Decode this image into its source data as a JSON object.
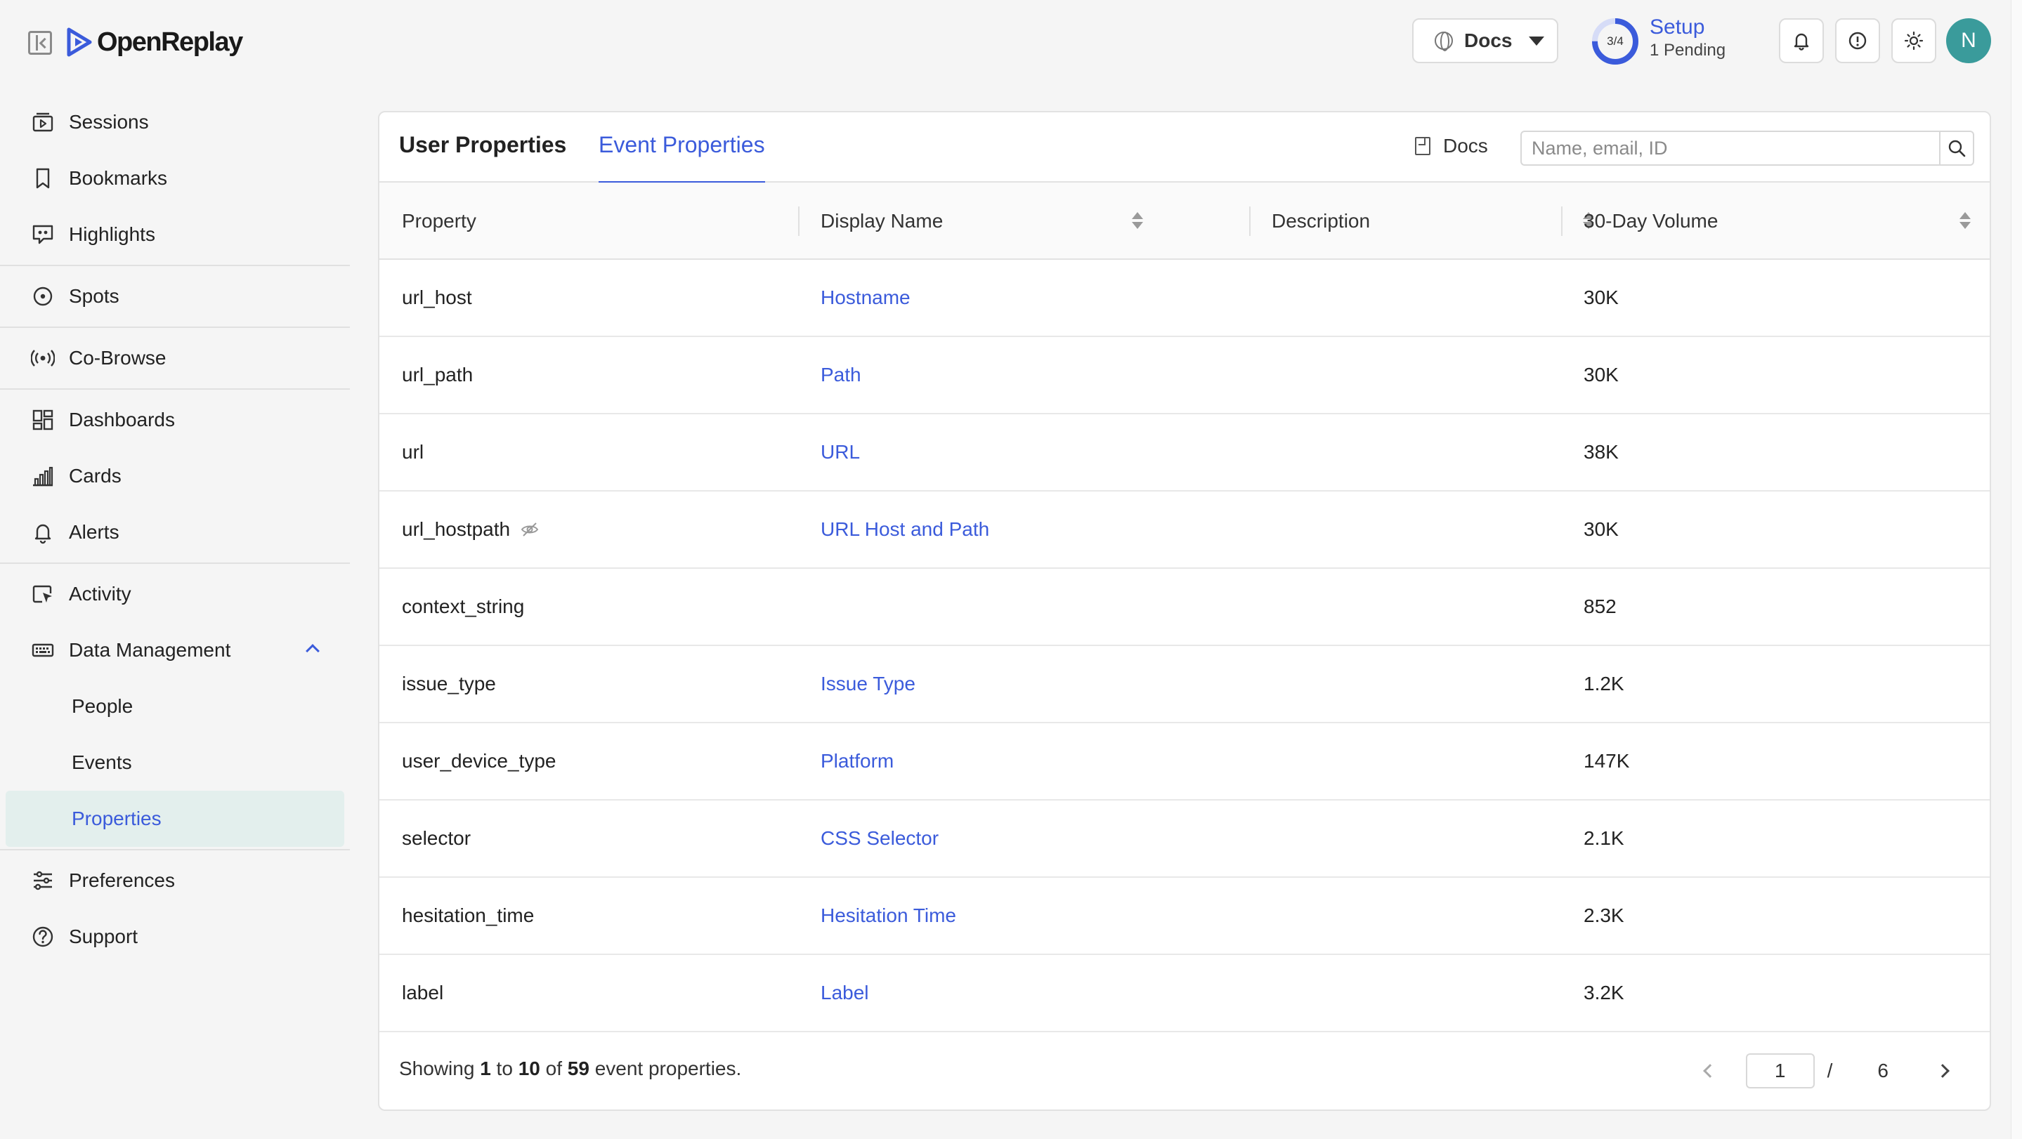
{
  "app": {
    "logo_text": "OpenReplay"
  },
  "header": {
    "docs_label": "Docs",
    "setup": {
      "progress": "3/4",
      "title": "Setup",
      "pending": "1 Pending"
    },
    "avatar_initial": "N"
  },
  "sidebar": {
    "items": [
      {
        "label": "Sessions",
        "icon": "sessions-icon"
      },
      {
        "label": "Bookmarks",
        "icon": "bookmark-icon"
      },
      {
        "label": "Highlights",
        "icon": "highlights-icon"
      },
      {
        "label": "Spots",
        "icon": "spots-icon"
      },
      {
        "label": "Co-Browse",
        "icon": "cobrowse-icon"
      },
      {
        "label": "Dashboards",
        "icon": "dashboards-icon"
      },
      {
        "label": "Cards",
        "icon": "cards-icon"
      },
      {
        "label": "Alerts",
        "icon": "bell-icon"
      },
      {
        "label": "Activity",
        "icon": "activity-icon"
      },
      {
        "label": "Data Management",
        "icon": "data-management-icon"
      },
      {
        "label": "Preferences",
        "icon": "sliders-icon"
      },
      {
        "label": "Support",
        "icon": "help-icon"
      }
    ],
    "data_management_sub": [
      "People",
      "Events",
      "Properties"
    ],
    "active_sub": "Properties"
  },
  "main": {
    "tabs": [
      {
        "label": "User Properties",
        "active": false
      },
      {
        "label": "Event Properties",
        "active": true
      }
    ],
    "docs_link": "Docs",
    "search_placeholder": "Name, email, ID",
    "columns": [
      "Property",
      "Display Name",
      "Description",
      "30-Day Volume"
    ],
    "rows": [
      {
        "property": "url_host",
        "display_name": "Hostname",
        "description": "",
        "volume": "30K",
        "hidden": false
      },
      {
        "property": "url_path",
        "display_name": "Path",
        "description": "",
        "volume": "30K",
        "hidden": false
      },
      {
        "property": "url",
        "display_name": "URL",
        "description": "",
        "volume": "38K",
        "hidden": false
      },
      {
        "property": "url_hostpath",
        "display_name": "URL Host and Path",
        "description": "",
        "volume": "30K",
        "hidden": true
      },
      {
        "property": "context_string",
        "display_name": "",
        "description": "",
        "volume": "852",
        "hidden": false
      },
      {
        "property": "issue_type",
        "display_name": "Issue Type",
        "description": "",
        "volume": "1.2K",
        "hidden": false
      },
      {
        "property": "user_device_type",
        "display_name": "Platform",
        "description": "",
        "volume": "147K",
        "hidden": false
      },
      {
        "property": "selector",
        "display_name": "CSS Selector",
        "description": "",
        "volume": "2.1K",
        "hidden": false
      },
      {
        "property": "hesitation_time",
        "display_name": "Hesitation Time",
        "description": "",
        "volume": "2.3K",
        "hidden": false
      },
      {
        "property": "label",
        "display_name": "Label",
        "description": "",
        "volume": "3.2K",
        "hidden": false
      }
    ],
    "footer": {
      "showing_prefix": "Showing",
      "from": "1",
      "to_word": "to",
      "to": "10",
      "of_word": "of",
      "total": "59",
      "suffix": "event properties.",
      "page": "1",
      "page_sep": "/",
      "pages": "6"
    }
  },
  "colors": {
    "accent": "#3b5bdb",
    "avatar": "#3a9b9b",
    "active_bg": "#e3efed"
  }
}
